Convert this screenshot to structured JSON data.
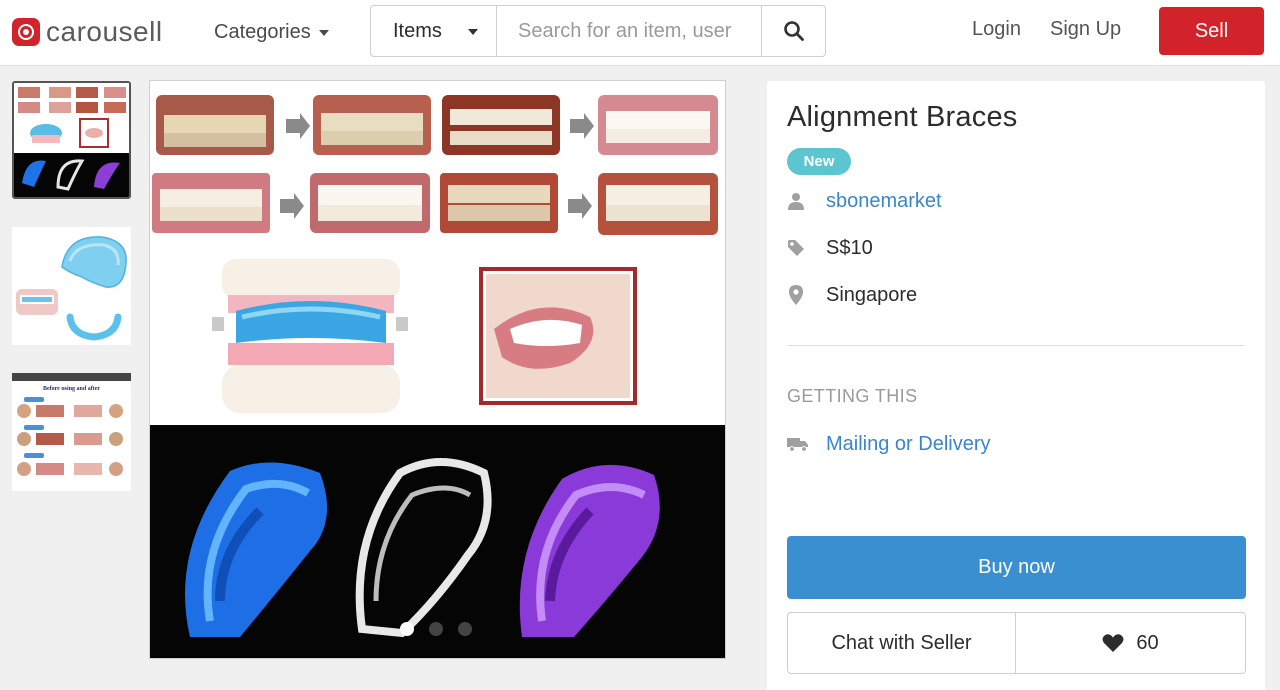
{
  "header": {
    "logo_text": "carousell",
    "categories_label": "Categories",
    "search_type": "Items",
    "search_placeholder": "Search for an item, user",
    "login_label": "Login",
    "signup_label": "Sign Up",
    "sell_label": "Sell",
    "brand_color": "#d2232a"
  },
  "gallery": {
    "thumbnail_count": 3,
    "active_index": 0,
    "dot_count": 3,
    "thumb3_caption": "Before using and after"
  },
  "listing": {
    "title": "Alignment Braces",
    "condition_badge": "New",
    "seller": "sbonemarket",
    "price": "S$10",
    "location": "Singapore",
    "getting_this_heading": "GETTING THIS",
    "delivery_option": "Mailing or Delivery",
    "buy_label": "Buy now",
    "chat_label": "Chat with Seller",
    "likes": "60"
  },
  "colors": {
    "accent_blue": "#3a8fd1",
    "link_blue": "#3a86c8",
    "badge_teal": "#5cc6d0"
  },
  "icons": {
    "search": "search-icon",
    "user": "user-icon",
    "price": "price-tag-icon",
    "location": "map-pin-icon",
    "delivery": "truck-icon",
    "like": "heart-icon"
  }
}
